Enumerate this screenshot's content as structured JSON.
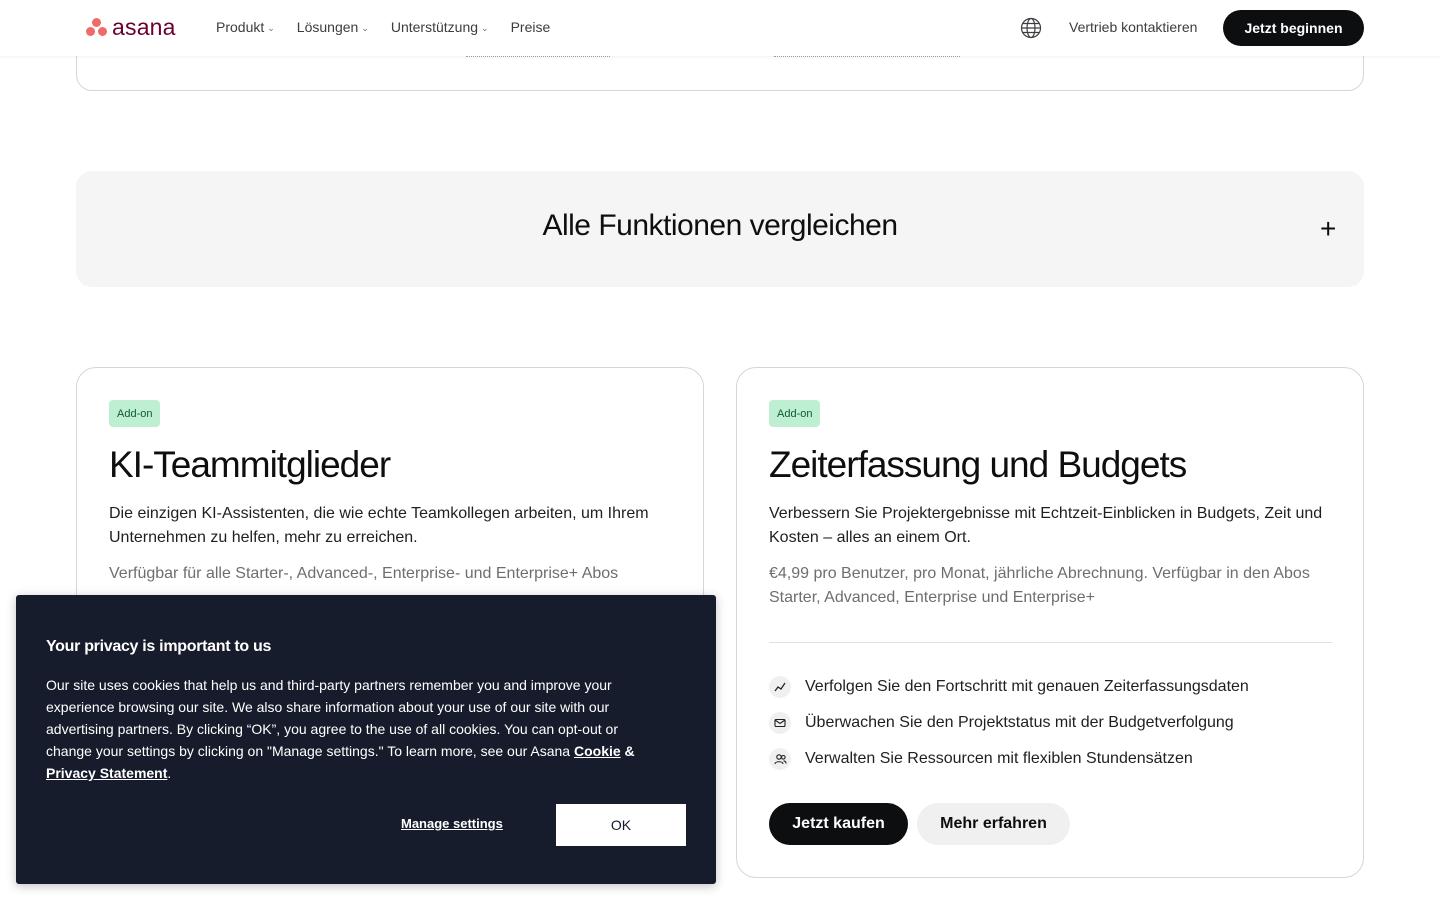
{
  "nav": {
    "logo_text": "asana",
    "menu": [
      {
        "label": "Produkt",
        "has_dropdown": true
      },
      {
        "label": "Lösungen",
        "has_dropdown": true
      },
      {
        "label": "Unterstützung",
        "has_dropdown": true
      },
      {
        "label": "Preise",
        "has_dropdown": false
      }
    ],
    "globe_icon": "globe-icon",
    "sales_link": "Vertrieb kontaktieren",
    "cta": "Jetzt beginnen"
  },
  "compare": {
    "title": "Alle Funktionen vergleichen",
    "toggle": "+"
  },
  "cards": [
    {
      "badge": "Add-on",
      "title": "KI-Teammitglieder",
      "description": "Die einzigen KI-Assistenten, die wie echte Teamkollegen arbeiten, um Ihrem Unternehmen zu helfen, mehr zu erreichen.",
      "note": "Verfügbar für alle Starter-, Advanced-, Enterprise- und Enterprise+ Abos"
    },
    {
      "badge": "Add-on",
      "title": "Zeiterfassung und Budgets",
      "description": "Verbessern Sie Projektergebnisse mit Echtzeit-Einblicken in Budgets, Zeit und Kosten – alles an einem Ort.",
      "note": "€4,99 pro Benutzer, pro Monat, jährliche Abrechnung. Verfügbar in den Abos Starter, Advanced, Enterprise und Enterprise+",
      "features": [
        {
          "icon": "trend-line-icon",
          "text": "Verfolgen Sie den Fortschritt mit genauen Zeiterfassungsdaten"
        },
        {
          "icon": "envelope-icon",
          "text": "Überwachen Sie den Projektstatus mit der Budgetverfolgung"
        },
        {
          "icon": "users-icon",
          "text": "Verwalten Sie Ressourcen mit flexiblen Stundensätzen"
        }
      ],
      "buy_label": "Jetzt kaufen",
      "more_label": "Mehr erfahren"
    }
  ],
  "cookie": {
    "title": "Your privacy is important to us",
    "text_before": "Our site uses cookies that help us and third-party partners remember you and improve your experience browsing our site. We also share information about your use of our site with our advertising partners. By clicking “OK”, you agree to the use of all cookies. You can opt-out or change your settings by clicking on \"Manage settings.\" To learn more, see our Asana ",
    "cookie_link": "Cookie",
    "amp": " & ",
    "privacy_link": "Privacy Statement",
    "text_after": ".",
    "manage_label": "Manage settings",
    "ok_label": "OK"
  }
}
